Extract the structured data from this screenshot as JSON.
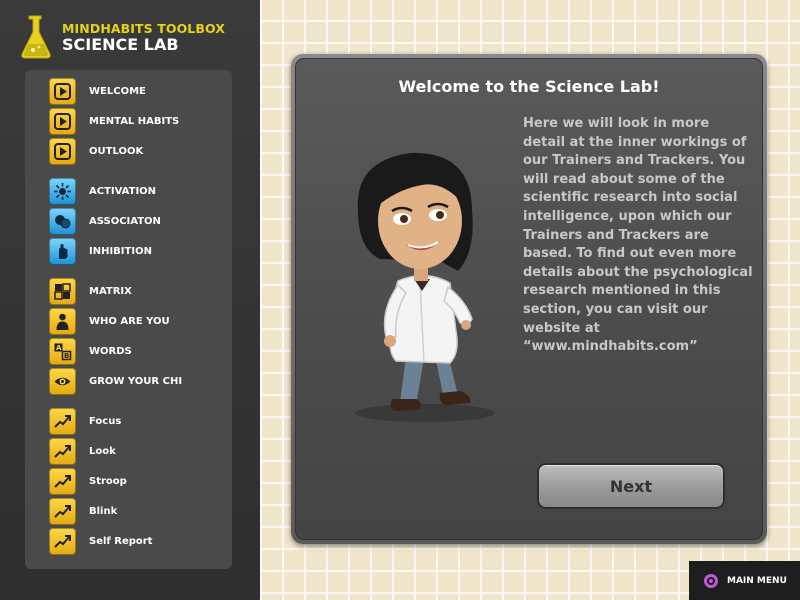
{
  "brand": {
    "line1": "MINDHABITS TOOLBOX",
    "line2": "SCIENCE LAB"
  },
  "menu": [
    {
      "label": "WELCOME",
      "icon": "play-icon",
      "color": "yellow"
    },
    {
      "label": "MENTAL HABITS",
      "icon": "play-icon",
      "color": "yellow"
    },
    {
      "label": "OUTLOOK",
      "icon": "play-icon",
      "color": "yellow"
    },
    {
      "label": "ACTIVATION",
      "icon": "burst-icon",
      "color": "blue"
    },
    {
      "label": "ASSOCIATON",
      "icon": "circles-icon",
      "color": "blue"
    },
    {
      "label": "INHIBITION",
      "icon": "hand-icon",
      "color": "blue"
    },
    {
      "label": "MATRIX",
      "icon": "grid-icon",
      "color": "yellow"
    },
    {
      "label": "WHO ARE YOU",
      "icon": "person-icon",
      "color": "yellow"
    },
    {
      "label": "WORDS",
      "icon": "letters-icon",
      "color": "yellow"
    },
    {
      "label": "GROW YOUR CHI",
      "icon": "eye-icon",
      "color": "yellow"
    },
    {
      "label": "Focus",
      "icon": "trend-icon",
      "color": "yellow"
    },
    {
      "label": "Look",
      "icon": "trend-icon",
      "color": "yellow"
    },
    {
      "label": "Stroop",
      "icon": "trend-icon",
      "color": "yellow"
    },
    {
      "label": "Blink",
      "icon": "trend-icon",
      "color": "yellow"
    },
    {
      "label": "Self Report",
      "icon": "trend-icon",
      "color": "yellow"
    }
  ],
  "dialog": {
    "title": "Welcome to the Science Lab!",
    "body": "Here we will look in more detail at the inner workings of our Trainers and Trackers. You will read about some of the scientific research into social intelligence, upon which our Trainers and Trackers are based.  To find out even more details about the psychological research mentioned in this section, you can visit our website at “www.mindhabits.com”",
    "next_label": "Next"
  },
  "main_menu": {
    "label": "MAIN MENU",
    "icon": "main-menu-icon"
  },
  "colors": {
    "brand_yellow": "#e6d21c",
    "panel": "#4a4a4a",
    "background_cream": "#f1e6cc"
  }
}
